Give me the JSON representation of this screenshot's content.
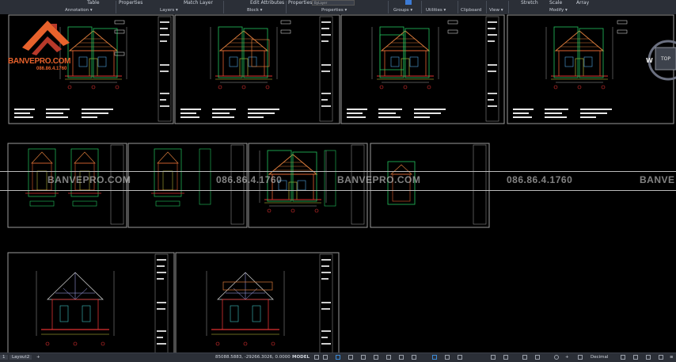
{
  "ribbon": {
    "controls": {
      "table": "Table",
      "properties": "Properties",
      "match_layer": "Match Layer",
      "edit_attributes": "Edit Attributes",
      "properties2": "Properties",
      "bylayer": "ByLayer",
      "stretch": "Stretch",
      "scale": "Scale",
      "array": "Array"
    },
    "groups": {
      "annotation": "Annotation ▾",
      "layers": "Layers ▾",
      "block": "Block ▾",
      "properties": "Properties ▾",
      "groups": "Groups ▾",
      "utilities": "Utilities ▾",
      "clipboard": "Clipboard",
      "view": "View ▾",
      "modify": "Modify ▾"
    }
  },
  "logo": {
    "brand": "BANVEPRO.COM",
    "phone": "086.86.4.1760",
    "colors": {
      "roof": "#e8622c",
      "roof_dark": "#b8392a"
    }
  },
  "watermark": {
    "items": [
      "BANVEPRO.COM",
      "086.86.4.1760",
      "BANVEPRO.COM",
      "086.86.4.1760",
      "BANVE"
    ]
  },
  "viewcube": {
    "top_label": "TOP",
    "west_label": "W"
  },
  "status": {
    "tab_layout1": "1",
    "tab_layout2": "Layout2",
    "add_tab": "+",
    "coordinates": "85088.5883, -29266.3026, 0.0000",
    "model": "MODEL",
    "units": "Decimal"
  },
  "colors": {
    "ribbon_bg": "#2b2f37",
    "canvas_bg": "#000000",
    "sheet_border": "#9a9a9a",
    "drawing_green": "#22c55e",
    "drawing_orange": "#d97a3a",
    "drawing_red": "#e03030"
  }
}
